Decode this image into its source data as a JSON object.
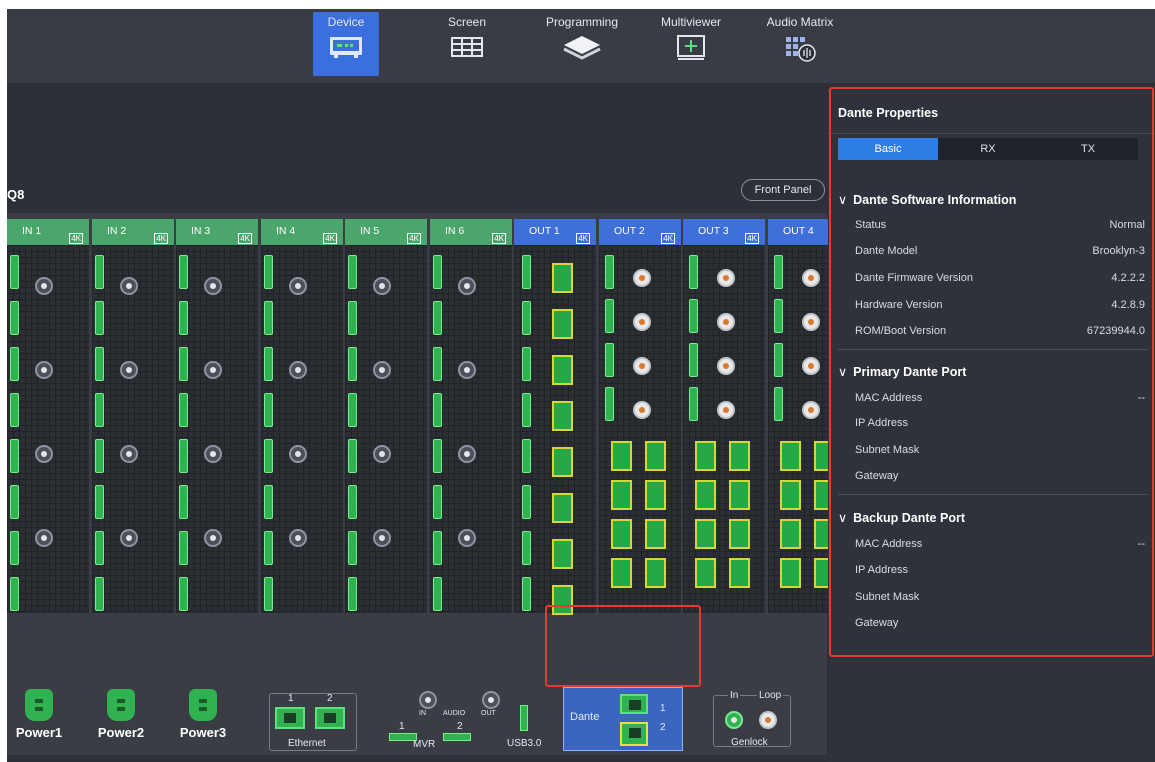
{
  "nav": {
    "tabs": [
      {
        "label": "Device",
        "icon": "device-icon",
        "active": true
      },
      {
        "label": "Screen",
        "icon": "screen-icon",
        "active": false
      },
      {
        "label": "Programming",
        "icon": "layers-icon",
        "active": false
      },
      {
        "label": "Multiviewer",
        "icon": "multiviewer-icon",
        "active": false
      },
      {
        "label": "Audio Matrix",
        "icon": "audio-matrix-icon",
        "active": false
      }
    ]
  },
  "device": {
    "name": "Q8",
    "front_panel_label": "Front Panel",
    "input_cards": [
      "IN 1",
      "IN 2",
      "IN 3",
      "IN 4",
      "IN 5",
      "IN 6"
    ],
    "output_cards": [
      "OUT 1",
      "OUT 2",
      "OUT 3",
      "OUT 4"
    ],
    "badge_4k": "4K",
    "power": [
      "Power1",
      "Power2",
      "Power3"
    ],
    "ethernet": {
      "label": "Ethernet",
      "port1": "1",
      "port2": "2"
    },
    "audio": {
      "in": "IN",
      "label": "AUDIO",
      "out": "OUT"
    },
    "mvr": {
      "label": "MVR",
      "port1": "1",
      "port2": "2"
    },
    "usb_label": "USB3.0",
    "dante": {
      "label": "Dante",
      "port1": "1",
      "port2": "2"
    },
    "genlock": {
      "label": "Genlock",
      "in": "In",
      "loop": "Loop"
    }
  },
  "props": {
    "title": "Dante Properties",
    "tabs": [
      "Basic",
      "RX",
      "TX"
    ],
    "active_tab": "Basic",
    "software_info": {
      "heading": "Dante Software Information",
      "rows": [
        {
          "label": "Status",
          "value": "Normal"
        },
        {
          "label": "Dante Model",
          "value": "Brooklyn-3"
        },
        {
          "label": "Dante Firmware Version",
          "value": "4.2.2.2"
        },
        {
          "label": "Hardware Version",
          "value": "4.2.8.9"
        },
        {
          "label": "ROM/Boot Version",
          "value": "67239944.0"
        }
      ]
    },
    "primary_port": {
      "heading": "Primary Dante Port",
      "rows": [
        {
          "label": "MAC Address",
          "value": "--"
        },
        {
          "label": "IP Address",
          "value": ""
        },
        {
          "label": "Subnet Mask",
          "value": ""
        },
        {
          "label": "Gateway",
          "value": ""
        }
      ]
    },
    "backup_port": {
      "heading": "Backup Dante Port",
      "rows": [
        {
          "label": "MAC Address",
          "value": "--"
        },
        {
          "label": "IP Address",
          "value": ""
        },
        {
          "label": "Subnet Mask",
          "value": ""
        },
        {
          "label": "Gateway",
          "value": ""
        }
      ]
    }
  },
  "colors": {
    "accent": "#3b6fe0",
    "input_green": "#4aa66a",
    "highlight": "#e53a32"
  }
}
